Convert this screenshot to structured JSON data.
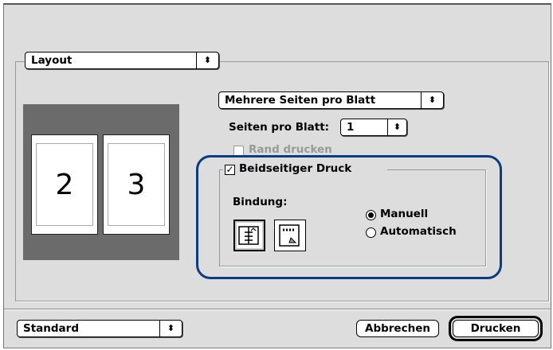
{
  "panel_popup": {
    "value": "Layout"
  },
  "layout_popup": {
    "value": "Mehrere Seiten pro Blatt"
  },
  "pages_per_sheet": {
    "label": "Seiten pro Blatt:",
    "value": "1"
  },
  "print_border": {
    "label": "Rand drucken",
    "checked": false,
    "enabled": false
  },
  "duplex": {
    "label": "Beidseitiger Druck",
    "checked": true,
    "binding_label": "Bindung:",
    "binding_options": [
      "book-binding-icon",
      "tablet-binding-icon"
    ],
    "selected_binding": "book-binding-icon",
    "modes": [
      {
        "label": "Manuell",
        "selected": true
      },
      {
        "label": "Automatisch",
        "selected": false
      }
    ]
  },
  "preview": {
    "pages": [
      "2",
      "3"
    ]
  },
  "footer": {
    "preset_popup": "Standard",
    "cancel_label": "Abbrechen",
    "print_label": "Drucken"
  },
  "colors": {
    "highlight": "#0b3b82",
    "preview_bg": "#6b6b6b",
    "dialog_bg": "#dddddd"
  }
}
